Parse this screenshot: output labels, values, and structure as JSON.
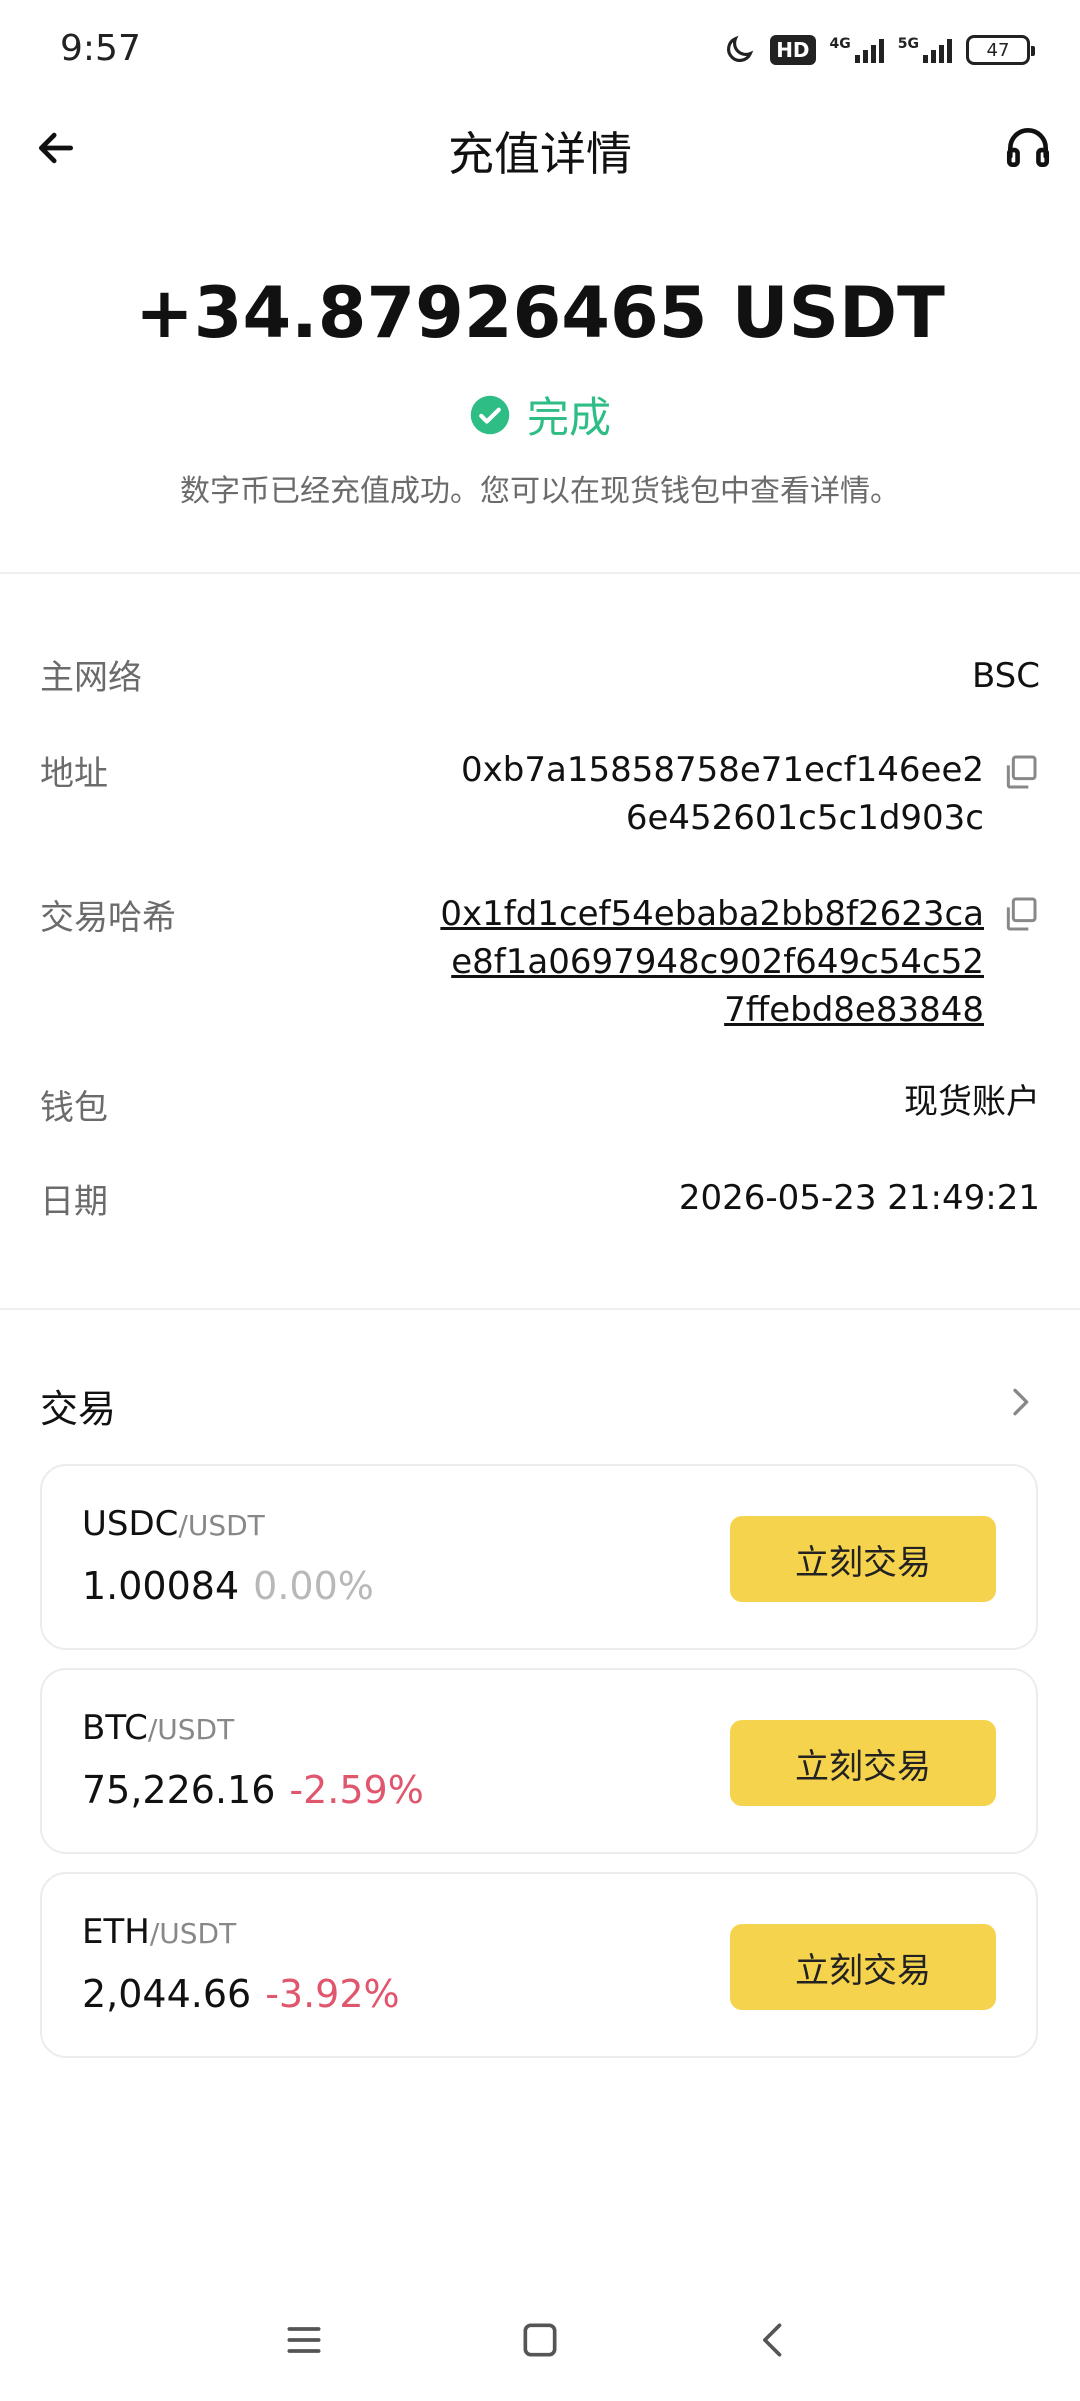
{
  "status_bar": {
    "time": "9:57",
    "hd_label": "HD",
    "network_1": "4G",
    "network_2": "5G",
    "battery": "47",
    "icons": [
      "moon-icon",
      "hd-icon",
      "signal-icon",
      "battery-icon"
    ]
  },
  "header": {
    "title": "充值详情",
    "back_icon": "arrow-left-icon",
    "support_icon": "headset-icon"
  },
  "summary": {
    "amount": "+34.87926465 USDT",
    "status": "完成",
    "status_icon": "check-circle-icon",
    "description": "数字币已经充值成功。您可以在现货钱包中查看详情。"
  },
  "details": {
    "network": {
      "label": "主网络",
      "value": "BSC"
    },
    "address": {
      "label": "地址",
      "lines": [
        "0xb7a15858758e71ecf146ee2",
        "6e452601c5c1d903c"
      ]
    },
    "tx_hash": {
      "label": "交易哈希",
      "lines": [
        "0x1fd1cef54ebaba2bb8f2623ca",
        "e8f1a0697948c902f649c54c52",
        "7ffebd8e83848"
      ]
    },
    "wallet": {
      "label": "钱包",
      "value": "现货账户"
    },
    "date": {
      "label": "日期",
      "value": "2026-05-23 21:49:21"
    }
  },
  "trade": {
    "title": "交易",
    "pairs": [
      {
        "base": "USDC",
        "quote": "/USDT",
        "price": "1.00084",
        "change": "0.00%",
        "direction": "neutral",
        "button": "立刻交易"
      },
      {
        "base": "BTC",
        "quote": "/USDT",
        "price": "75,226.16",
        "change": "-2.59%",
        "direction": "down",
        "button": "立刻交易"
      },
      {
        "base": "ETH",
        "quote": "/USDT",
        "price": "2,044.66",
        "change": "-3.92%",
        "direction": "down",
        "button": "立刻交易"
      }
    ]
  },
  "colors": {
    "success": "#2ebd85",
    "down": "#e0566c",
    "neutral": "#b8b8b8",
    "button": "#f6d34d"
  }
}
